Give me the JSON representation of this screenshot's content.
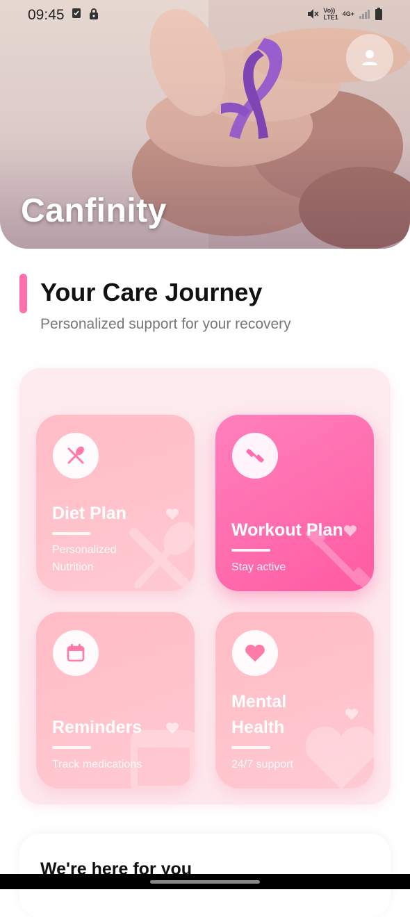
{
  "status_bar": {
    "time": "09:45",
    "icons": [
      "checkbox-icon",
      "lock-icon"
    ],
    "right_icons": [
      "mute-icon",
      "volte-icon",
      "4g-icon",
      "signal-icon",
      "battery-icon"
    ],
    "volte_text": "Vo))",
    "lte_text": "LTE1",
    "net_text": "4G+"
  },
  "hero": {
    "app_title": "Canfinity",
    "avatar_icon": "person-icon"
  },
  "section": {
    "title": "Your Care Journey",
    "subtitle": "Personalized support for your recovery",
    "accent_color": "#ff6fae"
  },
  "cards": [
    {
      "title_line1": "Diet Plan",
      "title_line2": "",
      "desc_line1": "Personalized",
      "desc_line2": "Nutrition",
      "icon": "fork-spoon-icon",
      "active": false
    },
    {
      "title_line1": "Workout Plan",
      "title_line2": "",
      "desc_line1": "Stay active",
      "desc_line2": "",
      "icon": "dumbbell-icon",
      "active": true
    },
    {
      "title_line1": "Reminders",
      "title_line2": "",
      "desc_line1": "Track medications",
      "desc_line2": "",
      "icon": "calendar-icon",
      "active": false
    },
    {
      "title_line1": "Mental",
      "title_line2": "Health",
      "desc_line1": "24/7 support",
      "desc_line2": "",
      "icon": "heart-icon",
      "active": false
    }
  ],
  "bottom": {
    "title": "We're here for you"
  },
  "colors": {
    "card_soft": "#ffc0c9",
    "card_active": "#ff6fb0",
    "icon_tint": "#ff7aa8"
  }
}
